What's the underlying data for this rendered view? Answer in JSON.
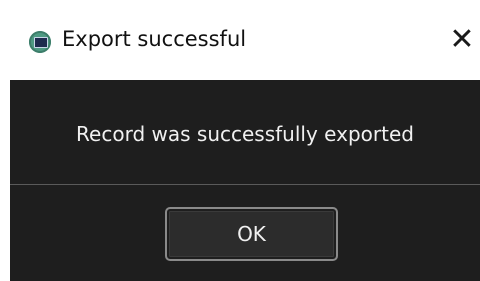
{
  "window": {
    "title": "Export successful",
    "close_glyph": "✕",
    "app_icon": "app-screen-icon"
  },
  "dialog": {
    "message": "Record was successfully exported",
    "ok_label": "OK"
  },
  "colors": {
    "titlebar_bg": "#ffffff",
    "content_bg": "#1e1e1e",
    "text_light": "#f0f0f0",
    "button_border": "#8a8a8a"
  }
}
